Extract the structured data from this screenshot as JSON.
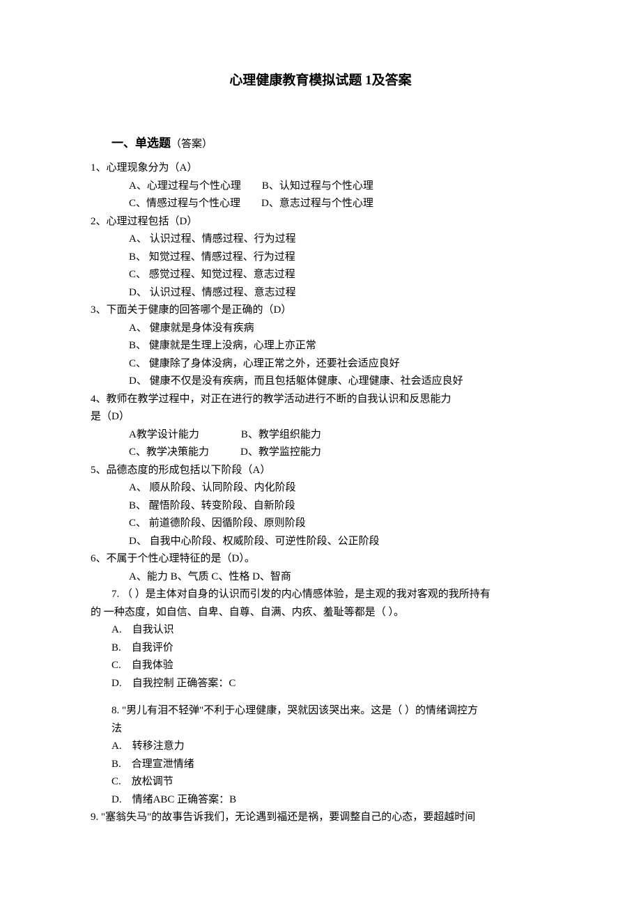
{
  "title": "心理健康教育模拟试题 1及答案",
  "section1": {
    "heading": "一、单选题",
    "sub": "（答案）"
  },
  "q1": {
    "stem": "1、心理现象分为（A）",
    "line1": "A、心理过程与个性心理　　B、认知过程与个性心理",
    "line2": "C、情感过程与个性心理　　D、意志过程与个性心理"
  },
  "q2": {
    "stem": "2、心理过程包括（D）",
    "optA": "A、 认识过程、情感过程、行为过程",
    "optB": "B、 知觉过程、情感过程、行为过程",
    "optC": "C、 感觉过程、知觉过程、意志过程",
    "optD": "D、 认识过程、情感过程、意志过程"
  },
  "q3": {
    "stem": "3、下面关于健康的回答哪个是正确的（D）",
    "optA": "A、 健康就是身体没有疾病",
    "optB": "B、 健康就是生理上没病，心理上亦正常",
    "optC": "C、 健康除了身体没病，心理正常之外，还要社会适应良好",
    "optD": "D、 健康不仅是没有疾病，而且包括躯体健康、心理健康、社会适应良好"
  },
  "q4": {
    "stem1": "4、教师在教学过程中，对正在进行的教学活动进行不断的自我认识和反思能力",
    "stem2": "是（D）",
    "line1": "A教学设计能力　　　　B、教学组织能力",
    "line2": "C、教学决策能力　　　D、教学监控能力"
  },
  "q5": {
    "stem": "5、品德态度的形成包括以下阶段（A）",
    "optA": "A、 顺从阶段、认同阶段、内化阶段",
    "optB": "B、 醒悟阶段、转变阶段、自新阶段",
    "optC": "C、 前道德阶段、因循阶段、原则阶段",
    "optD": "D、 自我中心阶段、权威阶段、可逆性阶段、公正阶段"
  },
  "q6": {
    "stem": "6、不属于个性心理特征的是（D）。",
    "opts": "A、能力 B、气质 C、性格 D、智商"
  },
  "q7": {
    "stem1": "7. （ ）是主体对自身的认识而引发的内心情感体验，是主观的我对客观的我所持有",
    "stem2": "的 一种态度，如自信、自卑、自尊、自满、内疚、羞耻等都是（ ）。",
    "optA": "A.　自我认识",
    "optB": "B.　自我评价",
    "optC": "C.　自我体验",
    "optD": "D.　自我控制 正确答案：C"
  },
  "q8": {
    "stem1": "8. \"男儿有泪不轻弹\"不利于心理健康，哭就因该哭出来。这是（ ）的情绪调控方",
    "stem2": "法",
    "optA": "A.　转移注意力",
    "optB": "B.　合理宣泄情绪",
    "optC": "C.　放松调节",
    "optD": "D.　情绪ABC 正确答案：B"
  },
  "q9": {
    "stem": "9. \"塞翁失马\"的故事告诉我们，无论遇到福还是祸，要调整自己的心态，要超越时间"
  }
}
